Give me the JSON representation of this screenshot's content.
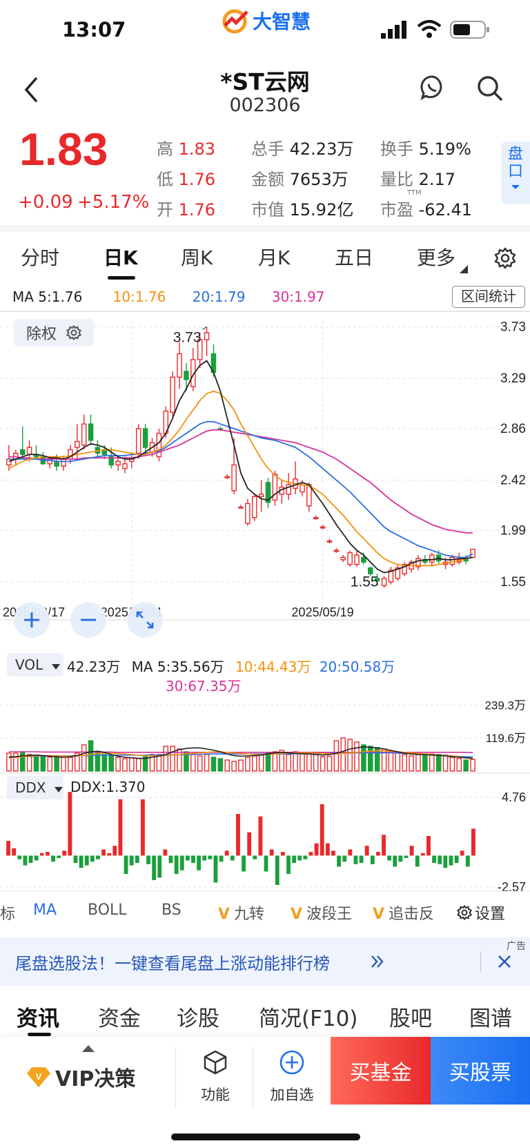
{
  "status_bar": {
    "time": "13:07",
    "app_logo": "大智慧"
  },
  "header": {
    "name": "*ST云网",
    "code": "002306"
  },
  "quote": {
    "price": "1.83",
    "change": "+0.09",
    "change_pct": "+5.17%",
    "high_label": "高",
    "high": "1.83",
    "low_label": "低",
    "low": "1.76",
    "open_label": "开",
    "open": "1.76",
    "vol_label": "总手",
    "vol": "42.23万",
    "amt_label": "金额",
    "amt": "7653万",
    "mcap_label": "市值",
    "mcap": "15.92亿",
    "turn_label": "换手",
    "turn": "5.19%",
    "ratio_label": "量比",
    "ratio": "2.17",
    "pe_label": "市盈",
    "pe_sup": "TTM",
    "pe": "-62.41",
    "pankou": "盘口"
  },
  "tabs": [
    "分时",
    "日K",
    "周K",
    "月K",
    "五日",
    "更多"
  ],
  "kline": {
    "ma5": "MA 5:1.76",
    "ma10": "10:1.76",
    "ma20": "20:1.79",
    "ma30": "30:1.97",
    "range_stats": "区间统计",
    "fuquan": "除权",
    "max_label": "3.73",
    "min_label": "1.55",
    "y_ticks": [
      "3.73",
      "3.29",
      "2.86",
      "2.42",
      "1.99",
      "1.55"
    ],
    "dates": [
      "2025/02/17",
      "2025/03/31",
      "2025/05/19"
    ]
  },
  "volume": {
    "selector": "VOL",
    "current": "42.23万",
    "ma5": "MA 5:35.56万",
    "ma10": "10:44.43万",
    "ma20": "20:50.58万",
    "ma30": "30:67.35万",
    "y_ticks": [
      "239.3万",
      "119.6万"
    ]
  },
  "ddx": {
    "selector": "DDX",
    "current": "DDX:1.370",
    "y_ticks": [
      "4.76",
      "-2.57"
    ]
  },
  "indicators": {
    "partial": "标",
    "ma": "MA",
    "boll": "BOLL",
    "bs": "BS",
    "jiuzhuan": "九转",
    "boduan": "波段王",
    "zhuiji": "追击反",
    "settings": "设置"
  },
  "banner": {
    "tag": "广告",
    "text": "尾盘选股法！一键查看尾盘上涨动能排行榜"
  },
  "news_tabs": [
    "资讯",
    "资金",
    "诊股",
    "简况(F10)",
    "股吧",
    "图谱"
  ],
  "bottom": {
    "vip": "VIP决策",
    "func": "功能",
    "add": "加自选",
    "buy_fund": "买基金",
    "buy_stock": "买股票"
  },
  "colors": {
    "up": "#e8292b",
    "down": "#1aa03c",
    "ma5": "#222222",
    "ma10": "#f5900a",
    "ma20": "#2a6fe0",
    "ma30": "#d8319a"
  },
  "chart_data": [
    {
      "type": "candlestick",
      "title": "日K",
      "x_range": [
        "2025/02/17",
        "2025/05/19"
      ],
      "ylim": [
        1.55,
        3.73
      ],
      "ohlc": [
        [
          2.55,
          2.72,
          2.5,
          2.6
        ],
        [
          2.6,
          2.68,
          2.55,
          2.65
        ],
        [
          2.68,
          2.88,
          2.6,
          2.64
        ],
        [
          2.64,
          2.76,
          2.58,
          2.7
        ],
        [
          2.64,
          2.72,
          2.6,
          2.62
        ],
        [
          2.62,
          2.66,
          2.55,
          2.56
        ],
        [
          2.56,
          2.62,
          2.52,
          2.6
        ],
        [
          2.58,
          2.64,
          2.5,
          2.54
        ],
        [
          2.54,
          2.63,
          2.5,
          2.6
        ],
        [
          2.6,
          2.72,
          2.56,
          2.68
        ],
        [
          2.7,
          2.9,
          2.6,
          2.75
        ],
        [
          2.72,
          2.98,
          2.68,
          2.9
        ],
        [
          2.9,
          2.98,
          2.72,
          2.76
        ],
        [
          2.7,
          2.76,
          2.62,
          2.65
        ],
        [
          2.68,
          2.72,
          2.6,
          2.64
        ],
        [
          2.62,
          2.7,
          2.52,
          2.55
        ],
        [
          2.55,
          2.62,
          2.5,
          2.58
        ],
        [
          2.52,
          2.62,
          2.48,
          2.56
        ],
        [
          2.58,
          2.64,
          2.52,
          2.6
        ],
        [
          2.65,
          2.9,
          2.6,
          2.86
        ],
        [
          2.86,
          2.9,
          2.66,
          2.7
        ],
        [
          2.66,
          2.78,
          2.62,
          2.74
        ],
        [
          2.62,
          2.86,
          2.58,
          2.82
        ],
        [
          2.82,
          3.05,
          2.78,
          3.01
        ],
        [
          3.0,
          3.35,
          2.96,
          3.3
        ],
        [
          3.3,
          3.6,
          3.2,
          3.5
        ],
        [
          3.35,
          3.42,
          3.18,
          3.28
        ],
        [
          3.22,
          3.55,
          3.18,
          3.45
        ],
        [
          3.45,
          3.68,
          3.38,
          3.62
        ],
        [
          3.62,
          3.73,
          3.48,
          3.68
        ],
        [
          3.5,
          3.58,
          3.3,
          3.34
        ],
        [
          2.86,
          2.88,
          2.84,
          2.85
        ],
        [
          2.45,
          2.47,
          2.43,
          2.45
        ],
        [
          2.33,
          2.78,
          2.3,
          2.55
        ],
        [
          2.19,
          2.21,
          2.18,
          2.19
        ],
        [
          2.05,
          2.26,
          2.03,
          2.22
        ],
        [
          2.1,
          2.3,
          2.07,
          2.28
        ],
        [
          2.28,
          2.42,
          2.15,
          2.3
        ],
        [
          2.4,
          2.44,
          2.18,
          2.23
        ],
        [
          2.25,
          2.5,
          2.2,
          2.47
        ],
        [
          2.3,
          2.42,
          2.22,
          2.36
        ],
        [
          2.3,
          2.48,
          2.25,
          2.38
        ],
        [
          2.35,
          2.58,
          2.3,
          2.43
        ],
        [
          2.32,
          2.42,
          2.28,
          2.38
        ],
        [
          2.2,
          2.4,
          2.15,
          2.38
        ],
        [
          2.1,
          2.12,
          2.08,
          2.1
        ],
        [
          2.02,
          2.04,
          2.0,
          2.02
        ],
        [
          1.9,
          1.92,
          1.88,
          1.9
        ],
        [
          1.82,
          1.84,
          1.8,
          1.82
        ],
        [
          1.74,
          1.78,
          1.72,
          1.76
        ],
        [
          1.7,
          1.82,
          1.68,
          1.8
        ],
        [
          1.7,
          1.82,
          1.68,
          1.78
        ],
        [
          1.76,
          1.8,
          1.7,
          1.72
        ],
        [
          1.67,
          1.68,
          1.6,
          1.62
        ],
        [
          1.58,
          1.62,
          1.52,
          1.56
        ],
        [
          1.52,
          1.6,
          1.5,
          1.58
        ],
        [
          1.55,
          1.68,
          1.53,
          1.65
        ],
        [
          1.58,
          1.7,
          1.56,
          1.67
        ],
        [
          1.62,
          1.72,
          1.6,
          1.7
        ],
        [
          1.66,
          1.74,
          1.63,
          1.72
        ],
        [
          1.68,
          1.78,
          1.65,
          1.75
        ],
        [
          1.74,
          1.78,
          1.7,
          1.72
        ],
        [
          1.72,
          1.8,
          1.68,
          1.78
        ],
        [
          1.78,
          1.82,
          1.7,
          1.73
        ],
        [
          1.7,
          1.76,
          1.66,
          1.72
        ],
        [
          1.7,
          1.78,
          1.68,
          1.76
        ],
        [
          1.72,
          1.8,
          1.7,
          1.74
        ],
        [
          1.74,
          1.78,
          1.7,
          1.73
        ],
        [
          1.76,
          1.83,
          1.76,
          1.83
        ]
      ],
      "ma5": [
        2.58,
        2.6,
        2.62,
        2.64,
        2.64,
        2.63,
        2.61,
        2.61,
        2.6,
        2.62,
        2.66,
        2.7,
        2.73,
        2.72,
        2.7,
        2.66,
        2.62,
        2.6,
        2.6,
        2.62,
        2.66,
        2.7,
        2.74,
        2.82,
        2.95,
        3.1,
        3.2,
        3.32,
        3.4,
        3.44,
        3.34,
        3.18,
        2.95,
        2.72,
        2.48,
        2.35,
        2.3,
        2.26,
        2.25,
        2.3,
        2.34,
        2.36,
        2.38,
        2.4,
        2.38,
        2.3,
        2.22,
        2.13,
        2.04,
        1.96,
        1.88,
        1.82,
        1.78,
        1.72,
        1.66,
        1.63,
        1.64,
        1.66,
        1.68,
        1.71,
        1.73,
        1.74,
        1.74,
        1.75,
        1.74,
        1.74,
        1.75,
        1.75,
        1.76
      ],
      "ma10": [
        2.52,
        2.55,
        2.58,
        2.6,
        2.61,
        2.62,
        2.62,
        2.62,
        2.62,
        2.63,
        2.64,
        2.65,
        2.66,
        2.67,
        2.68,
        2.68,
        2.67,
        2.66,
        2.65,
        2.64,
        2.64,
        2.66,
        2.68,
        2.72,
        2.78,
        2.85,
        2.94,
        3.02,
        3.1,
        3.16,
        3.18,
        3.16,
        3.1,
        3.02,
        2.9,
        2.8,
        2.7,
        2.6,
        2.52,
        2.46,
        2.42,
        2.4,
        2.39,
        2.38,
        2.37,
        2.34,
        2.3,
        2.24,
        2.18,
        2.12,
        2.05,
        1.98,
        1.92,
        1.86,
        1.8,
        1.75,
        1.72,
        1.7,
        1.69,
        1.69,
        1.69,
        1.69,
        1.69,
        1.7,
        1.71,
        1.72,
        1.73,
        1.75,
        1.76
      ],
      "ma20": [
        2.6,
        2.6,
        2.6,
        2.6,
        2.6,
        2.59,
        2.59,
        2.58,
        2.58,
        2.58,
        2.59,
        2.6,
        2.61,
        2.62,
        2.63,
        2.63,
        2.63,
        2.63,
        2.64,
        2.64,
        2.65,
        2.66,
        2.67,
        2.7,
        2.74,
        2.78,
        2.82,
        2.86,
        2.9,
        2.92,
        2.92,
        2.9,
        2.88,
        2.86,
        2.84,
        2.82,
        2.8,
        2.78,
        2.77,
        2.76,
        2.74,
        2.72,
        2.7,
        2.66,
        2.62,
        2.57,
        2.52,
        2.47,
        2.42,
        2.37,
        2.32,
        2.26,
        2.2,
        2.14,
        2.08,
        2.02,
        1.98,
        1.95,
        1.92,
        1.89,
        1.86,
        1.84,
        1.82,
        1.8,
        1.78,
        1.77,
        1.76,
        1.76,
        1.79
      ],
      "ma30": [
        2.62,
        2.62,
        2.61,
        2.61,
        2.6,
        2.6,
        2.6,
        2.6,
        2.6,
        2.6,
        2.6,
        2.61,
        2.61,
        2.61,
        2.61,
        2.61,
        2.61,
        2.61,
        2.61,
        2.62,
        2.63,
        2.64,
        2.66,
        2.68,
        2.7,
        2.72,
        2.75,
        2.78,
        2.81,
        2.84,
        2.85,
        2.85,
        2.84,
        2.83,
        2.82,
        2.81,
        2.8,
        2.79,
        2.78,
        2.77,
        2.76,
        2.75,
        2.74,
        2.72,
        2.7,
        2.68,
        2.66,
        2.63,
        2.6,
        2.56,
        2.52,
        2.48,
        2.44,
        2.4,
        2.35,
        2.3,
        2.25,
        2.21,
        2.17,
        2.13,
        2.1,
        2.07,
        2.04,
        2.02,
        2.0,
        1.99,
        1.98,
        1.97,
        1.97
      ]
    },
    {
      "type": "bar",
      "title": "VOL",
      "ylabel": "万",
      "ylim": [
        0,
        280
      ],
      "values": [
        65,
        65,
        70,
        60,
        55,
        55,
        50,
        52,
        55,
        50,
        65,
        95,
        110,
        70,
        60,
        55,
        50,
        45,
        48,
        45,
        52,
        60,
        60,
        90,
        90,
        80,
        70,
        60,
        55,
        60,
        50,
        45,
        40,
        35,
        40,
        50,
        55,
        60,
        65,
        70,
        75,
        60,
        70,
        68,
        65,
        60,
        52,
        54,
        110,
        120,
        115,
        105,
        95,
        90,
        85,
        80,
        70,
        65,
        60,
        55,
        60,
        60,
        62,
        60,
        58,
        50,
        45,
        40,
        42
      ],
      "ma5": [
        50,
        52,
        55,
        56,
        58,
        56,
        54,
        52,
        50,
        52,
        56,
        64,
        70,
        72,
        68,
        60,
        54,
        50,
        48,
        46,
        46,
        50,
        54,
        60,
        70,
        78,
        82,
        84,
        84,
        80,
        76,
        70,
        62,
        56,
        54,
        55,
        56,
        58,
        62,
        66,
        68,
        66,
        64,
        63,
        62,
        60,
        58,
        60,
        64,
        72,
        80,
        84,
        88,
        86,
        84,
        80,
        75,
        70,
        65,
        62,
        60,
        60,
        58,
        57,
        55,
        52,
        50,
        48,
        46
      ],
      "ma10": [
        48,
        50,
        52,
        54,
        55,
        56,
        56,
        55,
        54,
        54,
        55,
        57,
        60,
        63,
        65,
        65,
        64,
        62,
        60,
        58,
        56,
        55,
        55,
        56,
        58,
        60,
        62,
        64,
        66,
        68,
        70,
        70,
        68,
        66,
        64,
        62,
        60,
        60,
        60,
        62,
        64,
        65,
        66,
        66,
        66,
        65,
        64,
        63,
        63,
        64,
        66,
        68,
        70,
        72,
        74,
        74,
        72,
        70,
        68,
        66,
        64,
        62,
        60,
        58,
        56,
        55,
        52,
        48,
        44
      ],
      "ma20": [
        52,
        52,
        53,
        53,
        54,
        54,
        55,
        55,
        55,
        55,
        56,
        56,
        57,
        57,
        58,
        58,
        58,
        58,
        58,
        58,
        58,
        58,
        58,
        58,
        59,
        59,
        60,
        60,
        61,
        62,
        62,
        62,
        62,
        62,
        62,
        62,
        62,
        62,
        62,
        62,
        62,
        62,
        63,
        63,
        63,
        64,
        64,
        64,
        65,
        65,
        65,
        66,
        66,
        66,
        66,
        66,
        66,
        65,
        64,
        63,
        62,
        61,
        60,
        58,
        57,
        55,
        53,
        52,
        51
      ],
      "ma30": [
        70,
        70,
        70,
        70,
        70,
        69,
        69,
        69,
        69,
        69,
        69,
        69,
        69,
        69,
        69,
        69,
        68,
        68,
        68,
        68,
        68,
        68,
        68,
        68,
        68,
        68,
        68,
        68,
        68,
        68,
        68,
        68,
        68,
        68,
        68,
        68,
        68,
        68,
        68,
        68,
        68,
        68,
        68,
        68,
        68,
        68,
        68,
        68,
        68,
        68,
        68,
        68,
        68,
        68,
        68,
        68,
        68,
        68,
        68,
        68,
        68,
        68,
        68,
        68,
        68,
        68,
        68,
        68,
        67
      ]
    },
    {
      "type": "bar",
      "title": "DDX",
      "ylim": [
        -2.57,
        4.76
      ],
      "values": [
        1.2,
        0.6,
        -0.3,
        -0.8,
        -0.6,
        -0.4,
        0.2,
        0.3,
        -0.5,
        -0.2,
        0.4,
        5.2,
        -0.6,
        -1.0,
        -0.8,
        -0.5,
        -0.3,
        0.5,
        0.2,
        0.8,
        4.6,
        -1.5,
        -0.8,
        -0.6,
        4.6,
        -0.7,
        -2.0,
        -1.8,
        0.5,
        -0.6,
        -1.5,
        -1.2,
        -0.4,
        -0.6,
        -1.2,
        -0.4,
        -0.3,
        -2.2,
        -0.5,
        0.4,
        -0.4,
        3.4,
        -1.3,
        1.9,
        -0.3,
        3.2,
        -1.3,
        0.5,
        -2.4,
        0.3,
        -1.5,
        -0.6,
        -0.4,
        -0.3,
        0.3,
        1.0,
        4.2,
        1.0,
        0.4,
        -0.9,
        -0.5,
        0.5,
        -0.7,
        -0.6,
        0.8,
        -0.7,
        0.3,
        1.7,
        -0.4,
        -0.9,
        -0.5,
        -0.2,
        0.8,
        -0.9,
        0.2,
        1.6,
        -0.6,
        -0.7,
        -1.0,
        -0.8,
        -0.6,
        0.4,
        -0.9,
        2.2
      ]
    }
  ]
}
